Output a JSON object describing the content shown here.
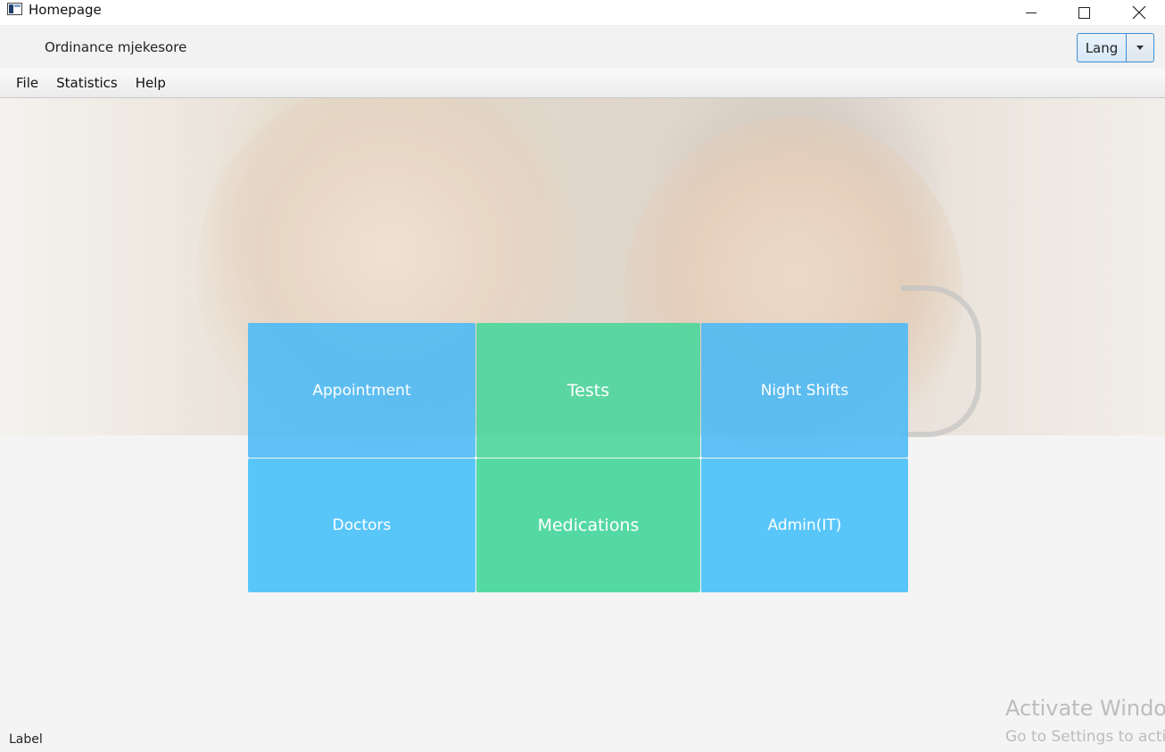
{
  "window": {
    "title": "Homepage",
    "icons": [
      "app-icon",
      "minimize-icon",
      "maximize-icon",
      "close-icon"
    ]
  },
  "header": {
    "title": "Ordinance mjekesore",
    "lang_button": "Lang"
  },
  "menu": {
    "items": [
      "File",
      "Statistics",
      "Help"
    ]
  },
  "tiles": [
    {
      "label": "Appointment",
      "color": "#50c3fa"
    },
    {
      "label": "Tests",
      "color": "#50d8a0"
    },
    {
      "label": "Night Shifts",
      "color": "#50c3fa"
    },
    {
      "label": "Doctors",
      "color": "#50c3fa"
    },
    {
      "label": "Medications",
      "color": "#50d8a0"
    },
    {
      "label": "Admin(IT)",
      "color": "#50c3fa"
    }
  ],
  "status": {
    "label": "Label"
  },
  "watermark": {
    "line1": "Activate Windo",
    "line2": "Go to Settings to acti"
  }
}
